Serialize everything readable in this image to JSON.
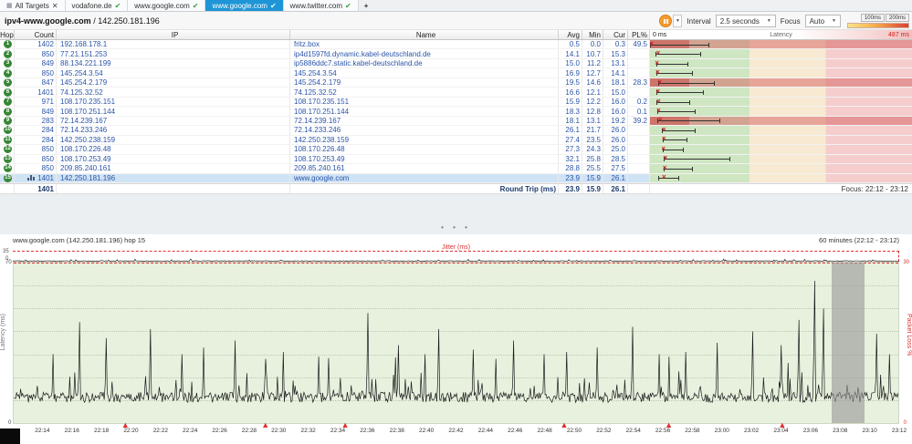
{
  "tabs": {
    "items": [
      {
        "label": "All Targets",
        "suffix": "close",
        "active": false
      },
      {
        "label": "vodafone.de",
        "suffix": "check",
        "active": false
      },
      {
        "label": "www.google.com",
        "suffix": "check",
        "active": false
      },
      {
        "label": "www.google.com",
        "suffix": "check",
        "active": true
      },
      {
        "label": "www.twitter.com",
        "suffix": "check",
        "active": false
      }
    ],
    "new_tab": "+"
  },
  "toolbar": {
    "target_name": "ipv4-www.google.com",
    "target_sep": " / ",
    "target_ip": "142.250.181.196",
    "interval_label": "Interval",
    "interval_value": "2.5 seconds",
    "focus_label": "Focus",
    "focus_value": "Auto",
    "scale_100": "100ms",
    "scale_200": "200ms"
  },
  "grid": {
    "headers": {
      "hop": "Hop",
      "count": "Count",
      "ip": "IP",
      "name": "Name",
      "avg": "Avg",
      "min": "Min",
      "cur": "Cur",
      "pl": "PL%",
      "latency": "Latency",
      "lat_min": "0 ms",
      "lat_max": "487 ms"
    },
    "rows": [
      {
        "hop": "1",
        "count": "1402",
        "ip": "192.168.178.1",
        "name": "fritz.box",
        "avg": "0.5",
        "min": "0.0",
        "cur": "0.3",
        "pl": "49.5",
        "loss": true,
        "selected": false,
        "chart": false,
        "lat_lo": 0,
        "lat_cur": 0.3,
        "lat_hi": 110
      },
      {
        "hop": "2",
        "count": "850",
        "ip": "77.21.151.253",
        "name": "ip4d1597fd.dynamic.kabel-deutschland.de",
        "avg": "14.1",
        "min": "10.7",
        "cur": "15.3",
        "pl": "",
        "loss": false,
        "selected": false,
        "chart": false,
        "lat_lo": 10.7,
        "lat_cur": 15.3,
        "lat_hi": 95
      },
      {
        "hop": "3",
        "count": "849",
        "ip": "88.134.221.199",
        "name": "ip5886ddc7.static.kabel-deutschland.de",
        "avg": "15.0",
        "min": "11.2",
        "cur": "13.1",
        "pl": "",
        "loss": false,
        "selected": false,
        "chart": false,
        "lat_lo": 11.2,
        "lat_cur": 13.1,
        "lat_hi": 72
      },
      {
        "hop": "4",
        "count": "850",
        "ip": "145.254.3.54",
        "name": "145.254.3.54",
        "avg": "16.9",
        "min": "12.7",
        "cur": "14.1",
        "pl": "",
        "loss": false,
        "selected": false,
        "chart": false,
        "lat_lo": 12.7,
        "lat_cur": 14.1,
        "lat_hi": 80
      },
      {
        "hop": "5",
        "count": "847",
        "ip": "145.254.2.179",
        "name": "145.254.2.179",
        "avg": "19.5",
        "min": "14.6",
        "cur": "18.1",
        "pl": "28.3",
        "loss": true,
        "selected": false,
        "chart": false,
        "lat_lo": 14.6,
        "lat_cur": 18.1,
        "lat_hi": 120
      },
      {
        "hop": "6",
        "count": "1401",
        "ip": "74.125.32.52",
        "name": "74.125.32.52",
        "avg": "16.6",
        "min": "12.1",
        "cur": "15.0",
        "pl": "",
        "loss": false,
        "selected": false,
        "chart": false,
        "lat_lo": 12.1,
        "lat_cur": 15.0,
        "lat_hi": 100
      },
      {
        "hop": "7",
        "count": "971",
        "ip": "108.170.235.151",
        "name": "108.170.235.151",
        "avg": "15.9",
        "min": "12.2",
        "cur": "16.0",
        "pl": "0.2",
        "loss": false,
        "selected": false,
        "chart": false,
        "lat_lo": 12.2,
        "lat_cur": 16.0,
        "lat_hi": 75
      },
      {
        "hop": "8",
        "count": "849",
        "ip": "108.170.251.144",
        "name": "108.170.251.144",
        "avg": "18.3",
        "min": "12.8",
        "cur": "16.0",
        "pl": "0.1",
        "loss": false,
        "selected": false,
        "chart": false,
        "lat_lo": 12.8,
        "lat_cur": 16.0,
        "lat_hi": 85
      },
      {
        "hop": "9",
        "count": "283",
        "ip": "72.14.239.167",
        "name": "72.14.239.167",
        "avg": "18.1",
        "min": "13.1",
        "cur": "19.2",
        "pl": "39.2",
        "loss": true,
        "selected": false,
        "chart": false,
        "lat_lo": 13.1,
        "lat_cur": 19.2,
        "lat_hi": 130
      },
      {
        "hop": "10",
        "count": "284",
        "ip": "72.14.233.246",
        "name": "72.14.233.246",
        "avg": "26.1",
        "min": "21.7",
        "cur": "26.0",
        "pl": "",
        "loss": false,
        "selected": false,
        "chart": false,
        "lat_lo": 21.7,
        "lat_cur": 26.0,
        "lat_hi": 85
      },
      {
        "hop": "11",
        "count": "284",
        "ip": "142.250.238.159",
        "name": "142.250.238.159",
        "avg": "27.4",
        "min": "23.5",
        "cur": "26.0",
        "pl": "",
        "loss": false,
        "selected": false,
        "chart": false,
        "lat_lo": 23.5,
        "lat_cur": 26.0,
        "lat_hi": 70
      },
      {
        "hop": "12",
        "count": "850",
        "ip": "108.170.226.48",
        "name": "108.170.226.48",
        "avg": "27.3",
        "min": "24.3",
        "cur": "25.0",
        "pl": "",
        "loss": false,
        "selected": false,
        "chart": false,
        "lat_lo": 24.3,
        "lat_cur": 25.0,
        "lat_hi": 62
      },
      {
        "hop": "13",
        "count": "850",
        "ip": "108.170.253.49",
        "name": "108.170.253.49",
        "avg": "32.1",
        "min": "25.8",
        "cur": "28.5",
        "pl": "",
        "loss": false,
        "selected": false,
        "chart": false,
        "lat_lo": 25.8,
        "lat_cur": 28.5,
        "lat_hi": 150
      },
      {
        "hop": "14",
        "count": "850",
        "ip": "209.85.240.161",
        "name": "209.85.240.161",
        "avg": "28.8",
        "min": "25.5",
        "cur": "27.5",
        "pl": "",
        "loss": false,
        "selected": false,
        "chart": false,
        "lat_lo": 25.5,
        "lat_cur": 27.5,
        "lat_hi": 80
      },
      {
        "hop": "15",
        "count": "1401",
        "ip": "142.250.181.196",
        "name": "www.google.com",
        "avg": "23.9",
        "min": "15.9",
        "cur": "26.1",
        "pl": "",
        "loss": false,
        "selected": true,
        "chart": true,
        "lat_lo": 15.9,
        "lat_cur": 26.1,
        "lat_hi": 55
      }
    ],
    "footer": {
      "count": "1401",
      "label": "Round Trip (ms)",
      "avg": "23.9",
      "min": "15.9",
      "cur": "26.1",
      "focus": "Focus: 22:12 - 23:12"
    }
  },
  "timeline": {
    "title": "www.google.com (142.250.181.196) hop 15",
    "range": "60 minutes (22:12 - 23:12)",
    "jitter": {
      "label": "Jitter (ms)",
      "max": "35",
      "min": "0"
    },
    "latency_axis": {
      "max": "70",
      "min": "0",
      "label": "Latency (ms)"
    },
    "loss_axis": {
      "max": "30",
      "min": "0",
      "label": "Packet Loss %"
    },
    "x_ticks": [
      "22:14",
      "22:16",
      "22:18",
      "22:20",
      "22:22",
      "22:24",
      "22:26",
      "22:28",
      "22:30",
      "22:32",
      "22:34",
      "22:36",
      "22:38",
      "22:40",
      "22:42",
      "22:44",
      "22:46",
      "22:48",
      "22:50",
      "22:52",
      "22:54",
      "22:56",
      "22:58",
      "23:00",
      "23:02",
      "23:04",
      "23:06",
      "23:08",
      "23:10",
      "23:12"
    ],
    "loss_markers": [
      0.127,
      0.285,
      0.375,
      0.622,
      0.74,
      0.868
    ],
    "gap_band": [
      0.925,
      0.962
    ],
    "baseline_ms": 11,
    "latency_scale_max": 70,
    "spikes": [
      [
        0.045,
        30
      ],
      [
        0.075,
        44
      ],
      [
        0.105,
        37
      ],
      [
        0.155,
        41
      ],
      [
        0.19,
        30
      ],
      [
        0.215,
        33
      ],
      [
        0.25,
        36
      ],
      [
        0.285,
        28
      ],
      [
        0.305,
        31
      ],
      [
        0.345,
        29
      ],
      [
        0.4,
        48
      ],
      [
        0.435,
        34
      ],
      [
        0.465,
        30
      ],
      [
        0.48,
        41
      ],
      [
        0.52,
        32
      ],
      [
        0.545,
        28
      ],
      [
        0.565,
        36
      ],
      [
        0.6,
        30
      ],
      [
        0.625,
        31
      ],
      [
        0.66,
        33
      ],
      [
        0.7,
        42
      ],
      [
        0.73,
        30
      ],
      [
        0.76,
        31
      ],
      [
        0.795,
        35
      ],
      [
        0.835,
        40
      ],
      [
        0.868,
        34
      ],
      [
        0.888,
        45
      ],
      [
        0.905,
        62
      ],
      [
        0.915,
        50
      ],
      [
        0.975,
        39
      ],
      [
        0.99,
        30
      ]
    ]
  }
}
